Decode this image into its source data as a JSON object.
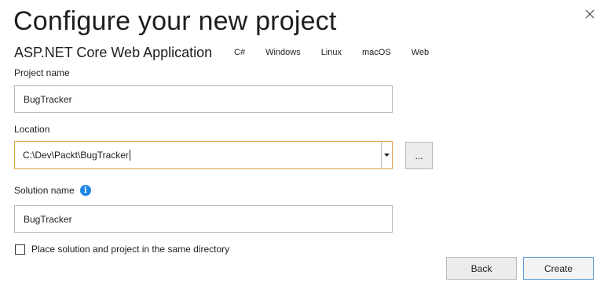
{
  "header": {
    "title": "Configure your new project",
    "subtitle": "ASP.NET Core Web Application",
    "tags": [
      "C#",
      "Windows",
      "Linux",
      "macOS",
      "Web"
    ]
  },
  "project_name": {
    "label": "Project name",
    "value": "BugTracker"
  },
  "location": {
    "label": "Location",
    "value": "C:\\Dev\\Packt\\BugTracker",
    "browse_label": "..."
  },
  "solution_name": {
    "label": "Solution name",
    "value": "BugTracker"
  },
  "same_directory": {
    "label": "Place solution and project in the same directory",
    "checked": false
  },
  "footer": {
    "back_label": "Back",
    "create_label": "Create"
  },
  "icons": {
    "close": "close-icon",
    "info": "info-icon",
    "dropdown": "chevron-down-icon"
  },
  "colors": {
    "focus_border": "#e0a74a",
    "primary_border": "#5b9bd5",
    "info": "#1e87e5"
  }
}
